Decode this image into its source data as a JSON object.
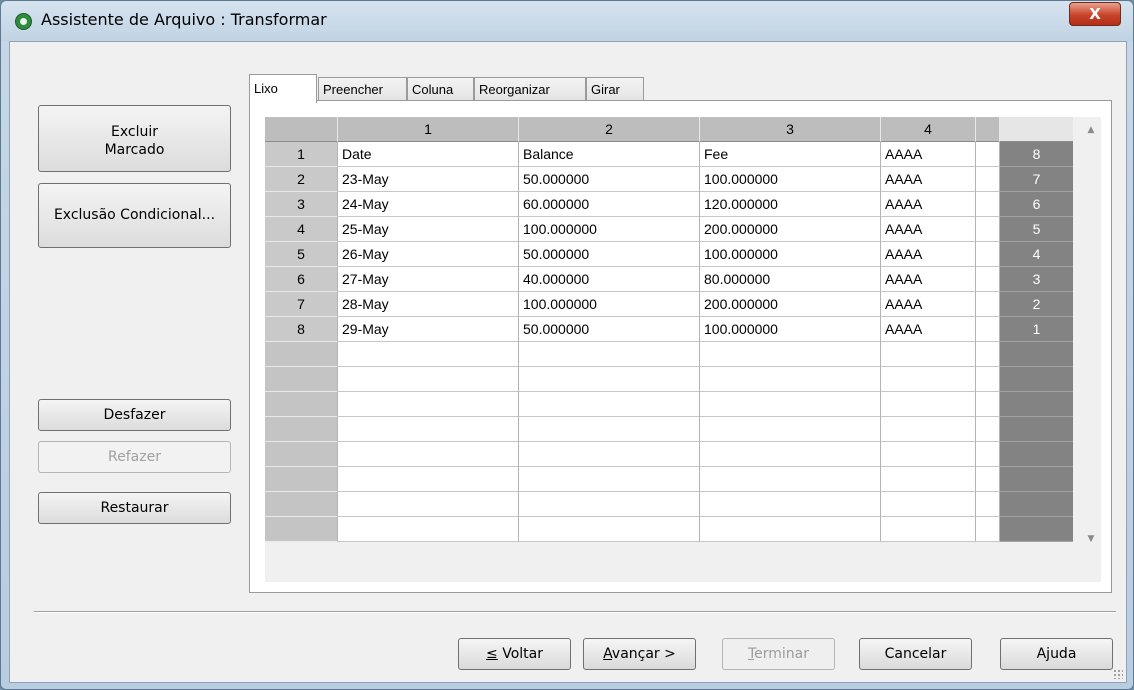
{
  "window": {
    "title": "Assistente de Arquivo : Transformar",
    "close_label": "X"
  },
  "sidebar": {
    "excluir_marcado_line1": "Excluir",
    "excluir_marcado_line2": "Marcado",
    "exclusao_condicional": "Exclusão Condicional...",
    "desfazer": "Desfazer",
    "refazer": "Refazer",
    "restaurar": "Restaurar"
  },
  "tabs": [
    "Lixo",
    "Preencher",
    "Coluna",
    "Reorganizar",
    "Girar"
  ],
  "active_tab": "Lixo",
  "table": {
    "column_headers": [
      "1",
      "2",
      "3",
      "4"
    ],
    "rows": [
      {
        "n": "1",
        "cells": [
          "Date",
          "Balance",
          "Fee",
          "AAAA"
        ],
        "rev": "8"
      },
      {
        "n": "2",
        "cells": [
          "23-May",
          "50.000000",
          "100.000000",
          "AAAA"
        ],
        "rev": "7"
      },
      {
        "n": "3",
        "cells": [
          "24-May",
          "60.000000",
          "120.000000",
          "AAAA"
        ],
        "rev": "6"
      },
      {
        "n": "4",
        "cells": [
          "25-May",
          "100.000000",
          "200.000000",
          "AAAA"
        ],
        "rev": "5"
      },
      {
        "n": "5",
        "cells": [
          "26-May",
          "50.000000",
          "100.000000",
          "AAAA"
        ],
        "rev": "4"
      },
      {
        "n": "6",
        "cells": [
          "27-May",
          "40.000000",
          "80.000000",
          "AAAA"
        ],
        "rev": "3"
      },
      {
        "n": "7",
        "cells": [
          "28-May",
          "100.000000",
          "200.000000",
          "AAAA"
        ],
        "rev": "2"
      },
      {
        "n": "8",
        "cells": [
          "29-May",
          "50.000000",
          "100.000000",
          "AAAA"
        ],
        "rev": "1"
      }
    ]
  },
  "footer": {
    "voltar_underline": "≤",
    "voltar_rest": " Voltar",
    "avancar_underline": "A",
    "avancar_rest": "vançar >",
    "terminar_underline": "T",
    "terminar_rest": "erminar",
    "cancelar": "Cancelar",
    "ajuda_pre": "A",
    "ajuda_underline": "j",
    "ajuda_post": "uda"
  },
  "icons": {
    "app": "app-icon",
    "scroll_up": "▲",
    "scroll_down": "▼"
  }
}
